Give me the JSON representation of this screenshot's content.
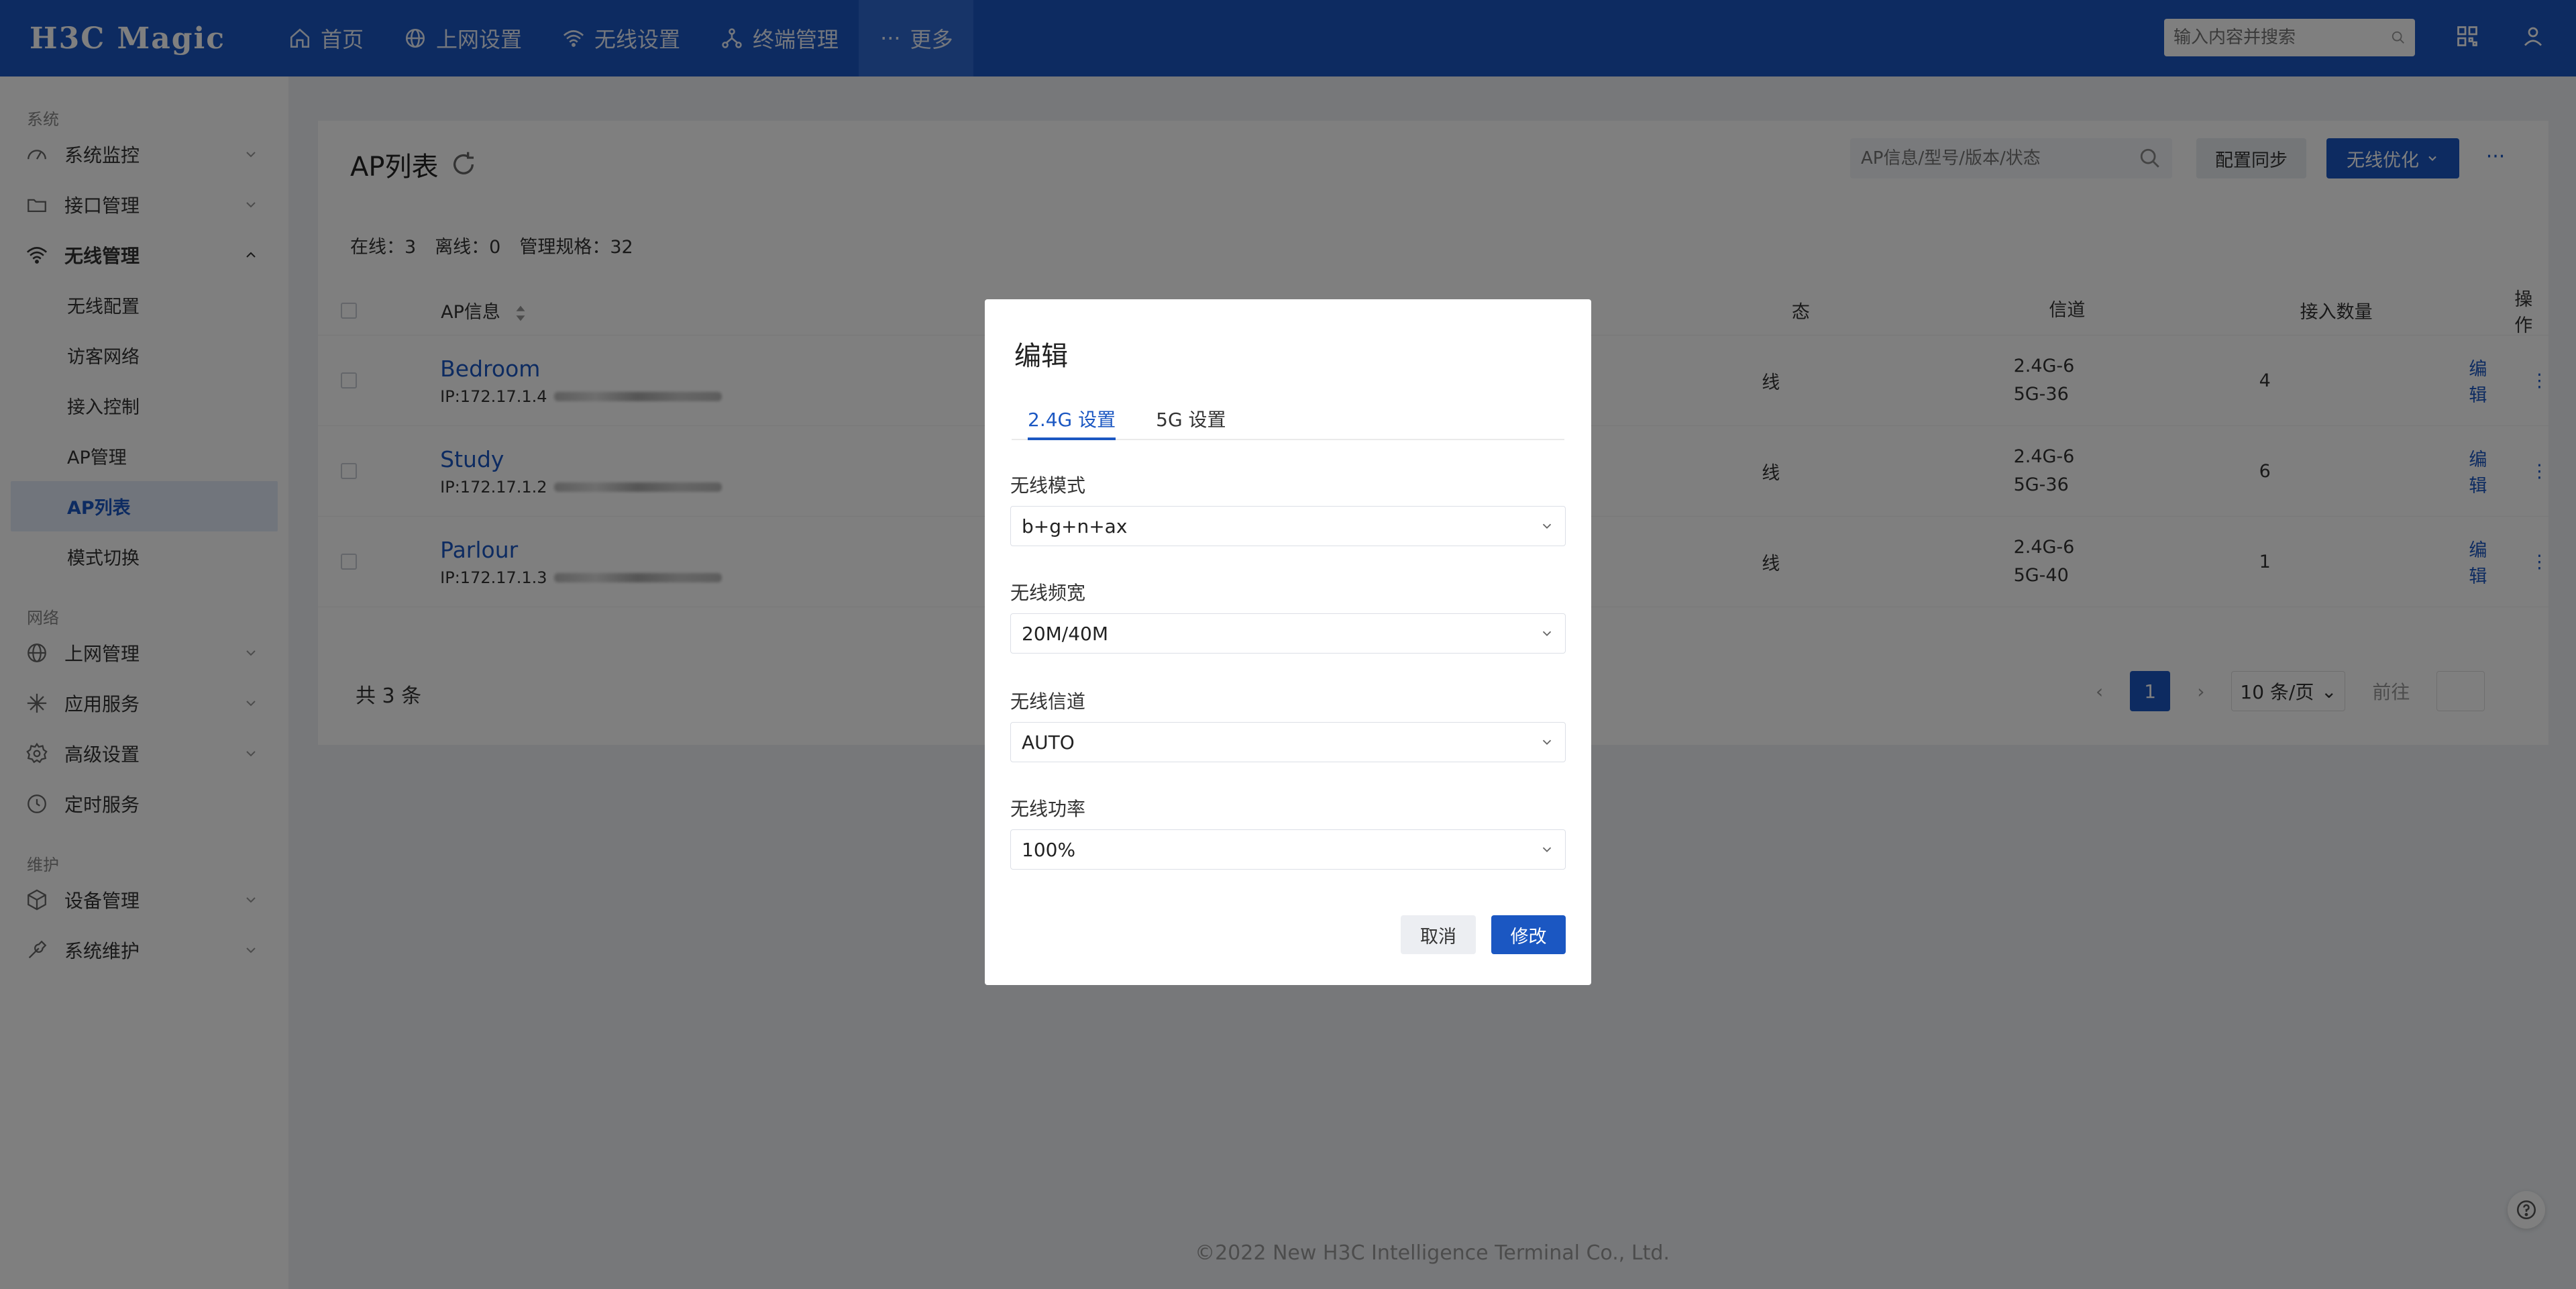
{
  "header": {
    "logo": "H3C Magic",
    "nav": [
      {
        "label": "首页",
        "icon": "home-icon"
      },
      {
        "label": "上网设置",
        "icon": "globe-icon"
      },
      {
        "label": "无线设置",
        "icon": "wifi-icon"
      },
      {
        "label": "终端管理",
        "icon": "network-icon"
      },
      {
        "label": "更多",
        "icon": "more-icon"
      }
    ],
    "search_placeholder": "输入内容并搜索"
  },
  "sidebar": {
    "group_system": "系统",
    "monitor": "系统监控",
    "interface": "接口管理",
    "wireless": "无线管理",
    "wireless_sub": [
      "无线配置",
      "访客网络",
      "接入控制",
      "AP管理",
      "AP列表",
      "模式切换"
    ],
    "group_network": "网络",
    "internet": "上网管理",
    "app": "应用服务",
    "advanced": "高级设置",
    "timer": "定时服务",
    "group_maint": "维护",
    "device": "设备管理",
    "sysmaint": "系统维护"
  },
  "main": {
    "title": "AP列表",
    "search_placeholder": "AP信息/型号/版本/状态",
    "sync_label": "配置同步",
    "optimize_label": "无线优化",
    "more_label": "···",
    "stats": {
      "online": "在线：3",
      "offline": "离线：0",
      "spec": "管理规格：32"
    },
    "columns": {
      "info": "AP信息",
      "status": "态",
      "channel": "信道",
      "count": "接入数量",
      "op": "操作"
    },
    "rows": [
      {
        "name": "Bedroom",
        "ip": "IP:172.17.1.4",
        "status": "线",
        "ch1": "2.4G-6",
        "ch2": "5G-36",
        "count": "4",
        "op": "编辑"
      },
      {
        "name": "Study",
        "ip": "IP:172.17.1.2",
        "status": "线",
        "ch1": "2.4G-6",
        "ch2": "5G-36",
        "count": "6",
        "op": "编辑"
      },
      {
        "name": "Parlour",
        "ip": "IP:172.17.1.3",
        "status": "线",
        "ch1": "2.4G-6",
        "ch2": "5G-40",
        "count": "1",
        "op": "编辑"
      }
    ],
    "total": "共 3 条",
    "pager": {
      "prev": "‹",
      "page": "1",
      "next": "›",
      "size": "10 条/页",
      "goto": "前往"
    }
  },
  "footer": "©2022 New H3C Intelligence Terminal Co., Ltd.",
  "modal": {
    "title": "编辑",
    "tabs": [
      "2.4G 设置",
      "5G 设置"
    ],
    "fields": [
      {
        "label": "无线模式",
        "value": "b+g+n+ax"
      },
      {
        "label": "无线频宽",
        "value": "20M/40M"
      },
      {
        "label": "无线信道",
        "value": "AUTO"
      },
      {
        "label": "无线功率",
        "value": "100%"
      }
    ],
    "cancel": "取消",
    "confirm": "修改"
  },
  "colors": {
    "brand": "#1b57c2",
    "overlay": "rgba(0,0,0,0.5)"
  }
}
